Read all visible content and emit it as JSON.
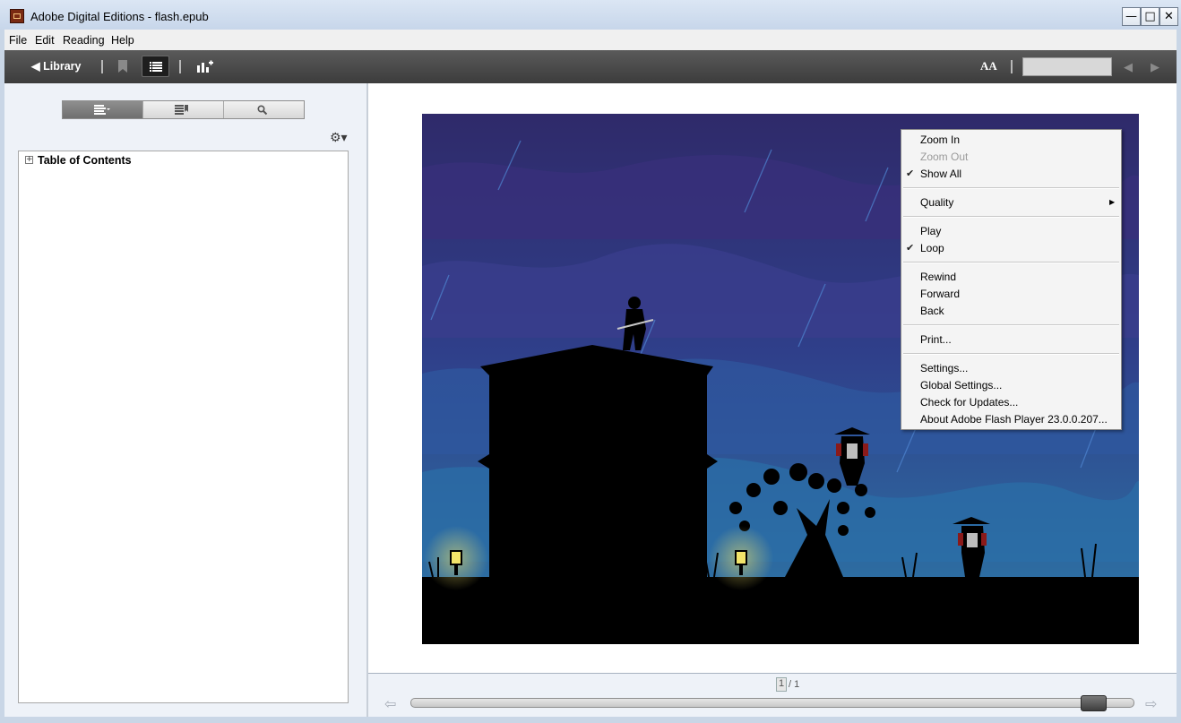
{
  "window": {
    "title": "Adobe Digital Editions - flash.epub",
    "min_glyph": "—",
    "max_glyph": "□",
    "close_glyph": "✕"
  },
  "menubar": {
    "items": [
      "File",
      "Edit",
      "Reading",
      "Help"
    ]
  },
  "toolbar": {
    "library_label": "◀ Library",
    "font_size_label": "AA",
    "prev_arrow": "◀",
    "next_arrow": "▶"
  },
  "sidebar": {
    "toc_title": "Table of Contents",
    "gear_glyph": "⚙▾",
    "expand_glyph": "+"
  },
  "context_menu": {
    "zoom_in": "Zoom In",
    "zoom_out": "Zoom Out",
    "show_all": "Show All",
    "quality": "Quality",
    "play": "Play",
    "loop": "Loop",
    "rewind": "Rewind",
    "forward": "Forward",
    "back": "Back",
    "print": "Print...",
    "settings": "Settings...",
    "global_settings": "Global Settings...",
    "check_updates": "Check for Updates...",
    "about": "About Adobe Flash Player 23.0.0.207...",
    "check_glyph": "✔",
    "submenu_glyph": "▶"
  },
  "pagination": {
    "current": "1",
    "total": "/ 1",
    "progress": 0.96
  },
  "colors": {
    "sky_top": "#2f2a6a",
    "sky_bottom": "#2c7aa8",
    "ground": "#000000",
    "lantern": "#f2e46a"
  }
}
